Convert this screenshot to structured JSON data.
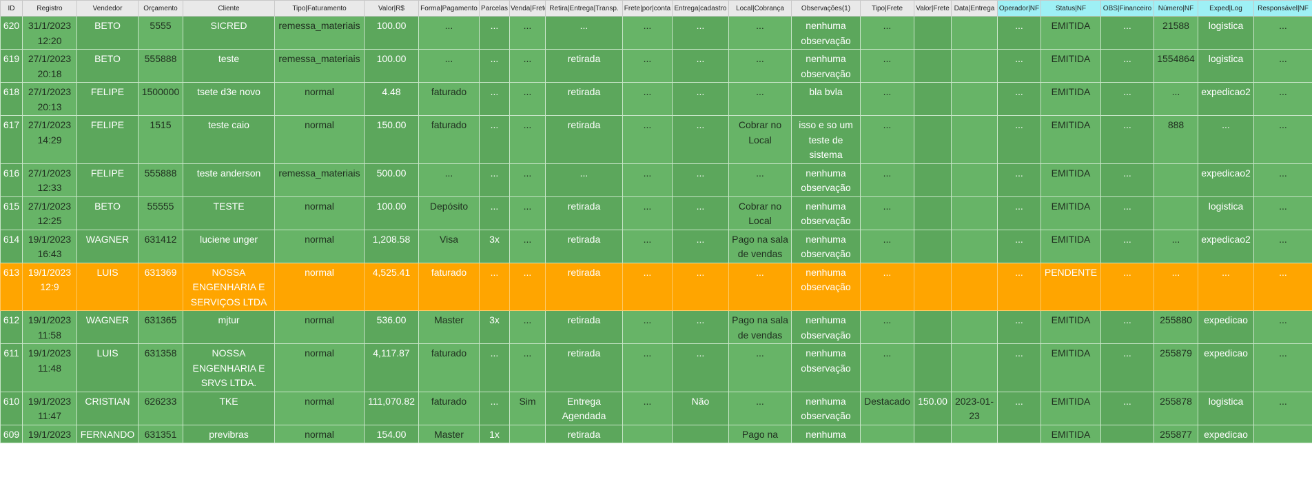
{
  "headers": [
    "ID",
    "Registro",
    "Vendedor",
    "Orçamento",
    "Cliente",
    "Tipo|Faturamento",
    "Valor|R$",
    "Forma|Pagamento",
    "Parcelas",
    "Venda|Frete",
    "Retira|Entrega|Transp.",
    "Frete|por|conta",
    "Entrega|cadastro",
    "Local|Cobrança",
    "Observações(1)",
    "Tipo|Frete",
    "Valor|Frete",
    "Data|Entrega",
    "Operador|NF",
    "Status|NF",
    "OBS|Financeiro",
    "Número|NF",
    "Exped|Log",
    "Responsável|NF"
  ],
  "header_highlight_color": "#9ef0f5",
  "row_colors": {
    "green_odd": "#5ca75c",
    "green_even": "#67b467",
    "orange": "#ffa500"
  },
  "rows": [
    {
      "status": "green",
      "cells": [
        "620",
        "31/1/2023 12:20",
        "BETO",
        "5555",
        "SICRED",
        "remessa_materiais",
        "100.00",
        "...",
        "...",
        "...",
        "...",
        "...",
        "...",
        "...",
        "nenhuma observação",
        "...",
        "",
        "",
        "...",
        "EMITIDA",
        "...",
        "21588",
        "logistica",
        "..."
      ]
    },
    {
      "status": "green",
      "cells": [
        "619",
        "27/1/2023 20:18",
        "BETO",
        "555888",
        "teste",
        "remessa_materiais",
        "100.00",
        "...",
        "...",
        "...",
        "retirada",
        "...",
        "...",
        "...",
        "nenhuma observação",
        "...",
        "",
        "",
        "...",
        "EMITIDA",
        "...",
        "1554864",
        "logistica",
        "..."
      ]
    },
    {
      "status": "green",
      "cells": [
        "618",
        "27/1/2023 20:13",
        "FELIPE",
        "1500000",
        "tsete d3e novo",
        "normal",
        "4.48",
        "faturado",
        "...",
        "...",
        "retirada",
        "...",
        "...",
        "...",
        "bla bvla",
        "...",
        "",
        "",
        "...",
        "EMITIDA",
        "...",
        "...",
        "expedicao2",
        "..."
      ]
    },
    {
      "status": "green",
      "cells": [
        "617",
        "27/1/2023 14:29",
        "FELIPE",
        "1515",
        "teste caio",
        "normal",
        "150.00",
        "faturado",
        "...",
        "...",
        "retirada",
        "...",
        "...",
        "Cobrar no Local",
        "isso e so um teste de sistema",
        "...",
        "",
        "",
        "...",
        "EMITIDA",
        "...",
        "888",
        "...",
        "..."
      ]
    },
    {
      "status": "green",
      "cells": [
        "616",
        "27/1/2023 12:33",
        "FELIPE",
        "555888",
        "teste anderson",
        "remessa_materiais",
        "500.00",
        "...",
        "...",
        "...",
        "...",
        "...",
        "...",
        "...",
        "nenhuma observação",
        "...",
        "",
        "",
        "...",
        "EMITIDA",
        "...",
        "",
        "expedicao2",
        "..."
      ]
    },
    {
      "status": "green",
      "cells": [
        "615",
        "27/1/2023 12:25",
        "BETO",
        "55555",
        "TESTE",
        "normal",
        "100.00",
        "Depósito",
        "...",
        "...",
        "retirada",
        "...",
        "...",
        "Cobrar no Local",
        "nenhuma observação",
        "...",
        "",
        "",
        "...",
        "EMITIDA",
        "...",
        "",
        "logistica",
        "..."
      ]
    },
    {
      "status": "green",
      "cells": [
        "614",
        "19/1/2023 16:43",
        "WAGNER",
        "631412",
        "luciene unger",
        "normal",
        "1,208.58",
        "Visa",
        "3x",
        "...",
        "retirada",
        "...",
        "...",
        "Pago na sala de vendas",
        "nenhuma observação",
        "...",
        "",
        "",
        "...",
        "EMITIDA",
        "...",
        "...",
        "expedicao2",
        "..."
      ]
    },
    {
      "status": "orange",
      "cells": [
        "613",
        "19/1/2023 12:9",
        "LUIS",
        "631369",
        "NOSSA ENGENHARIA E SERVIÇOS LTDA",
        "normal",
        "4,525.41",
        "faturado",
        "...",
        "...",
        "retirada",
        "...",
        "...",
        "...",
        "nenhuma observação",
        "...",
        "",
        "",
        "...",
        "PENDENTE",
        "...",
        "...",
        "...",
        "..."
      ]
    },
    {
      "status": "green",
      "cells": [
        "612",
        "19/1/2023 11:58",
        "WAGNER",
        "631365",
        "mjtur",
        "normal",
        "536.00",
        "Master",
        "3x",
        "...",
        "retirada",
        "...",
        "...",
        "Pago na sala de vendas",
        "nenhuma observação",
        "...",
        "",
        "",
        "...",
        "EMITIDA",
        "...",
        "255880",
        "expedicao",
        "..."
      ]
    },
    {
      "status": "green",
      "cells": [
        "611",
        "19/1/2023 11:48",
        "LUIS",
        "631358",
        "NOSSA ENGENHARIA E SRVS LTDA.",
        "normal",
        "4,117.87",
        "faturado",
        "...",
        "...",
        "retirada",
        "...",
        "...",
        "...",
        "nenhuma observação",
        "...",
        "",
        "",
        "...",
        "EMITIDA",
        "...",
        "255879",
        "expedicao",
        "..."
      ]
    },
    {
      "status": "green",
      "cells": [
        "610",
        "19/1/2023 11:47",
        "CRISTIAN",
        "626233",
        "TKE",
        "normal",
        "111,070.82",
        "faturado",
        "...",
        "Sim",
        "Entrega Agendada",
        "...",
        "Não",
        "...",
        "nenhuma observação",
        "Destacado",
        "150.00",
        "2023-01-23",
        "...",
        "EMITIDA",
        "...",
        "255878",
        "logistica",
        "..."
      ]
    },
    {
      "status": "green",
      "cells": [
        "609",
        "19/1/2023",
        "FERNANDO",
        "631351",
        "previbras",
        "normal",
        "154.00",
        "Master",
        "1x",
        "",
        "retirada",
        "",
        "",
        "Pago na",
        "nenhuma",
        "",
        "",
        "",
        "",
        "EMITIDA",
        "",
        "255877",
        "expedicao",
        ""
      ]
    }
  ]
}
